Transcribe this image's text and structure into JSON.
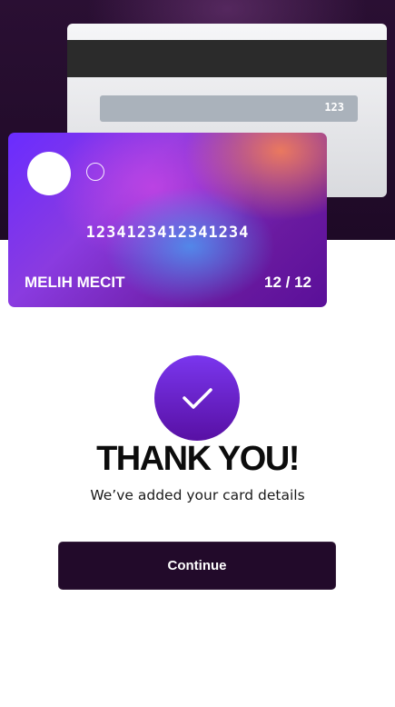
{
  "card_back": {
    "cvv": "123"
  },
  "card_front": {
    "number": "1234123412341234",
    "holder": "MELIH MECIT",
    "expiry": "12 / 12"
  },
  "success": {
    "icon": "checkmark-icon",
    "title": "THANK YOU!",
    "subtitle": "We’ve added your card details"
  },
  "actions": {
    "continue_label": "Continue"
  },
  "colors": {
    "background_top": "#210c2a",
    "button": "#220a2a",
    "badge_start": "#7a36ee",
    "badge_end": "#5810a4"
  }
}
